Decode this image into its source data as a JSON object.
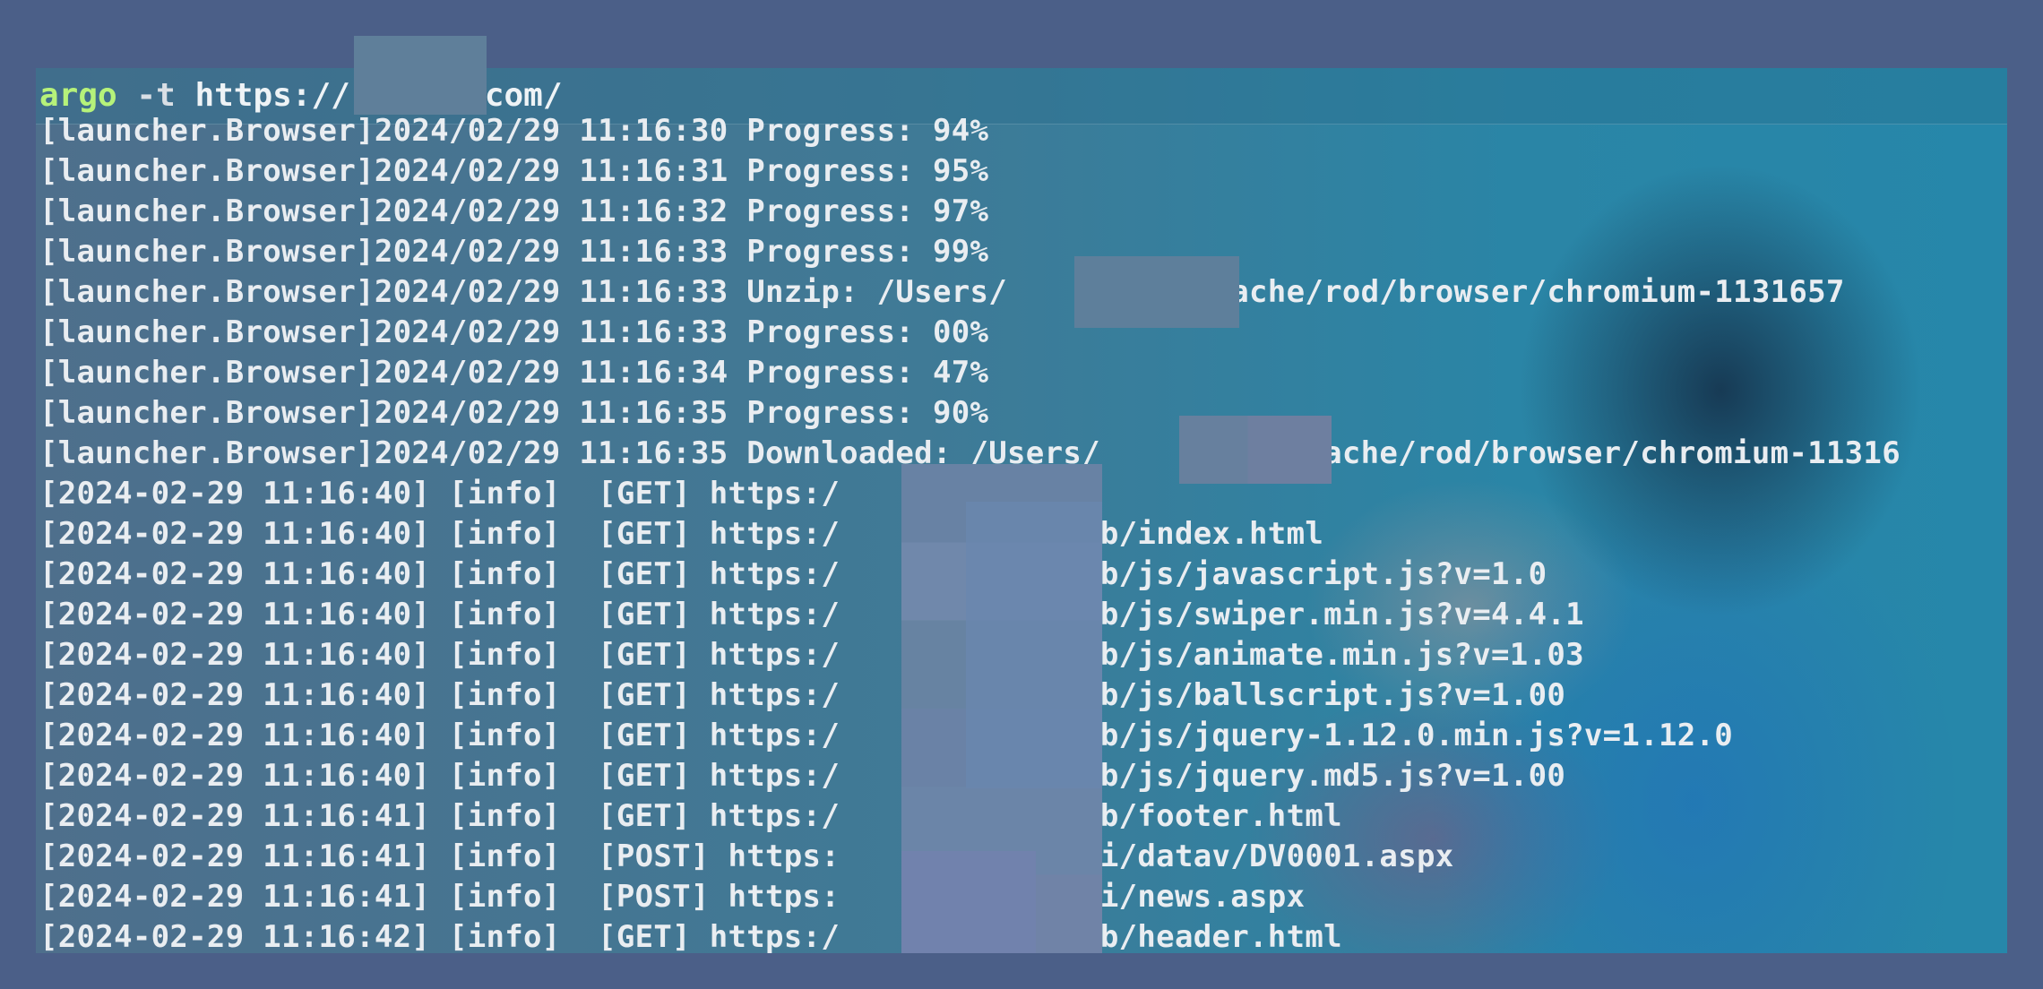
{
  "command": {
    "program": "argo",
    "flag": "-t",
    "url": "https://",
    "url_suffix": "com/"
  },
  "log_lines": [
    "[launcher.Browser]2024/02/29 11:16:30 Progress: 94%",
    "[launcher.Browser]2024/02/29 11:16:31 Progress: 95%",
    "[launcher.Browser]2024/02/29 11:16:32 Progress: 97%",
    "[launcher.Browser]2024/02/29 11:16:33 Progress: 99%",
    "[launcher.Browser]2024/02/29 11:16:33 Unzip: /Users/         /.cache/rod/browser/chromium-1131657",
    "[launcher.Browser]2024/02/29 11:16:33 Progress: 00%",
    "[launcher.Browser]2024/02/29 11:16:34 Progress: 47%",
    "[launcher.Browser]2024/02/29 11:16:35 Progress: 90%",
    "[launcher.Browser]2024/02/29 11:16:35 Downloaded: /Users/         /.cache/rod/browser/chromium-11316",
    "[2024-02-29 11:16:40] [info]  [GET] https:/          n/",
    "[2024-02-29 11:16:40] [info]  [GET] https:/          n/web/index.html",
    "[2024-02-29 11:16:40] [info]  [GET] https:/          n/web/js/javascript.js?v=1.0",
    "[2024-02-29 11:16:40] [info]  [GET] https:/          n/web/js/swiper.min.js?v=4.4.1",
    "[2024-02-29 11:16:40] [info]  [GET] https:/          n/web/js/animate.min.js?v=1.03",
    "[2024-02-29 11:16:40] [info]  [GET] https:/          n/web/js/ballscript.js?v=1.00",
    "[2024-02-29 11:16:40] [info]  [GET] https:/          n/web/js/jquery-1.12.0.min.js?v=1.12.0",
    "[2024-02-29 11:16:40] [info]  [GET] https:/          n/web/js/jquery.md5.js?v=1.00",
    "[2024-02-29 11:16:41] [info]  [GET] https:/          n/web/footer.html",
    "[2024-02-29 11:16:41] [info]  [POST] https:         om/api/datav/DV0001.aspx",
    "[2024-02-29 11:16:41] [info]  [POST] https:         om/api/news.aspx",
    "[2024-02-29 11:16:42] [info]  [GET] https:/          n/web/header.html"
  ]
}
